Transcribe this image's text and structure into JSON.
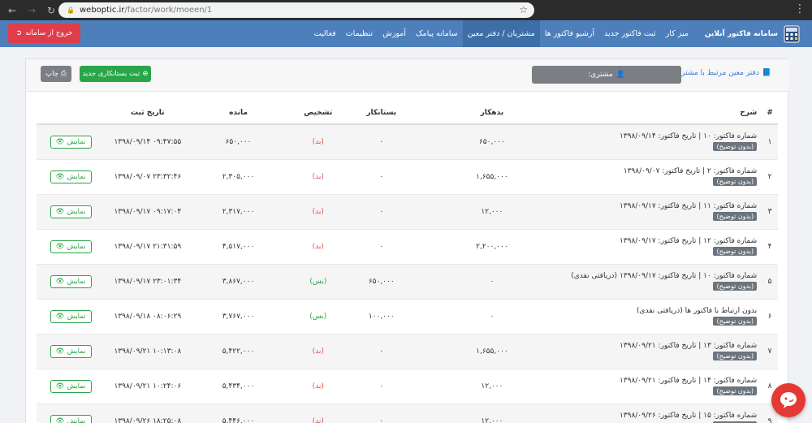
{
  "browser": {
    "url_host": "weboptic.ir",
    "url_path": "/factor/work/moeen/1"
  },
  "header": {
    "brand": "سامانه فاکتور آنلاین",
    "nav": [
      "میز کار",
      "ثبت فاکتور جدید",
      "آرشیو فاکتور ها",
      "مشتریان / دفتر معین",
      "سامانه پیامک",
      "آموزش",
      "تنظیمات",
      "فعالیت"
    ],
    "logout": "خروج از سامانه"
  },
  "toolbar": {
    "customer_book_link": "دفتر معین مرتبط با مشتری",
    "customer_label": "مشتری:",
    "new_credit_button": "ثبت بستانکاری جدید",
    "print_button": "چاپ"
  },
  "table": {
    "headers": {
      "idx": "#",
      "desc": "شرح",
      "debit": "بدهکار",
      "credit": "بستانکار",
      "detection": "تشخیص",
      "balance": "مانده",
      "date": "تاریخ ثبت"
    },
    "show_label": "نمایش",
    "badge": "(بدون توضیح)",
    "rows": [
      {
        "idx": "۱",
        "desc": "شماره فاکتور: ۱۰ | تاریخ فاکتور: ۱۳۹۸/۰۹/۱۴",
        "debit": "۶۵۰,۰۰۰",
        "credit": "۰",
        "det": "(بد)",
        "det_type": "bed",
        "balance": "۶۵۰,۰۰۰",
        "date": "۰۹:۴۷:۵۵ ۱۳۹۸/۰۹/۱۴"
      },
      {
        "idx": "۲",
        "desc": "شماره فاکتور: ۲ | تاریخ فاکتور: ۱۳۹۸/۰۹/۰۷",
        "debit": "۱,۶۵۵,۰۰۰",
        "credit": "۰",
        "det": "(بد)",
        "det_type": "bed",
        "balance": "۲,۳۰۵,۰۰۰",
        "date": "۲۳:۳۲:۴۶ ۱۳۹۸/۰۹/۰۷"
      },
      {
        "idx": "۳",
        "desc": "شماره فاکتور: ۱۱ | تاریخ فاکتور: ۱۳۹۸/۰۹/۱۷",
        "debit": "۱۲,۰۰۰",
        "credit": "۰",
        "det": "(بد)",
        "det_type": "bed",
        "balance": "۲,۳۱۷,۰۰۰",
        "date": "۰۹:۱۷:۰۴ ۱۳۹۸/۰۹/۱۷"
      },
      {
        "idx": "۴",
        "desc": "شماره فاکتور: ۱۲ | تاریخ فاکتور: ۱۳۹۸/۰۹/۱۷",
        "debit": "۲,۲۰۰,۰۰۰",
        "credit": "۰",
        "det": "(بد)",
        "det_type": "bed",
        "balance": "۴,۵۱۷,۰۰۰",
        "date": "۲۱:۳۱:۵۹ ۱۳۹۸/۰۹/۱۷"
      },
      {
        "idx": "۵",
        "desc": "شماره فاکتور: ۱۰ | تاریخ فاکتور: ۱۳۹۸/۰۹/۱۷ (دریافتی نقدی)",
        "debit": "۰",
        "credit": "۶۵۰,۰۰۰",
        "det": "(بس)",
        "det_type": "bes",
        "balance": "۳,۸۶۷,۰۰۰",
        "date": "۲۳:۰۱:۳۴ ۱۳۹۸/۰۹/۱۷"
      },
      {
        "idx": "۶",
        "desc": "بدون ارتباط با فاکتور ها (دریافتی نقدی)",
        "debit": "۰",
        "credit": "۱۰۰,۰۰۰",
        "det": "(بس)",
        "det_type": "bes",
        "balance": "۳,۷۶۷,۰۰۰",
        "date": "۰۸:۰۶:۲۹ ۱۳۹۸/۰۹/۱۸"
      },
      {
        "idx": "۷",
        "desc": "شماره فاکتور: ۱۳ | تاریخ فاکتور: ۱۳۹۸/۰۹/۲۱",
        "debit": "۱,۶۵۵,۰۰۰",
        "credit": "۰",
        "det": "(بد)",
        "det_type": "bed",
        "balance": "۵,۴۲۲,۰۰۰",
        "date": "۱۰:۱۳:۰۸ ۱۳۹۸/۰۹/۲۱"
      },
      {
        "idx": "۸",
        "desc": "شماره فاکتور: ۱۴ | تاریخ فاکتور: ۱۳۹۸/۰۹/۲۱",
        "debit": "۱۲,۰۰۰",
        "credit": "۰",
        "det": "(بد)",
        "det_type": "bed",
        "balance": "۵,۴۳۴,۰۰۰",
        "date": "۱۰:۲۴:۰۶ ۱۳۹۸/۰۹/۲۱"
      },
      {
        "idx": "۹",
        "desc": "شماره فاکتور: ۱۵ | تاریخ فاکتور: ۱۳۹۸/۰۹/۲۶",
        "debit": "۱۲,۰۰۰",
        "credit": "۰",
        "det": "(بد)",
        "det_type": "bed",
        "balance": "۵,۴۴۶,۰۰۰",
        "date": "۱۸:۲۵:۰۸ ۱۳۹۸/۰۹/۲۶"
      }
    ]
  },
  "colors": {
    "header_bg": "#4d7fbb",
    "logout_bg": "#e03c4a",
    "green": "#2aa548",
    "red_text": "#d9534f",
    "gray_btn": "#7b7f85"
  }
}
